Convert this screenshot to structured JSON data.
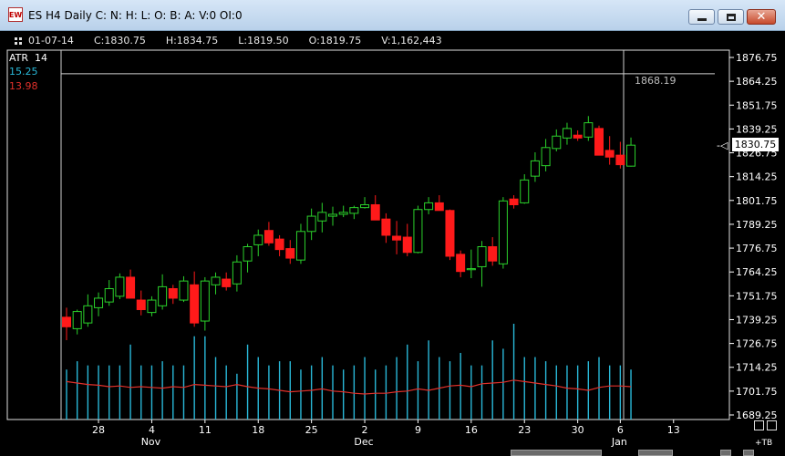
{
  "window": {
    "title": "ES H4 Daily C: N: H: L: O: B: A: V:0 OI:0",
    "app_icon_text": "EW"
  },
  "ohlc": {
    "date": "01-07-14",
    "close": "C:1830.75",
    "high": "H:1834.75",
    "low": "L:1819.50",
    "open": "O:1819.75",
    "volume": "V:1,162,443"
  },
  "indicator": {
    "name": "ATR",
    "period": "14",
    "value1": "15.25",
    "value2": "13.98"
  },
  "current_price": "1830.75",
  "crosshair_price": "1868.19",
  "toolbar_label": "+TB",
  "colors": {
    "up": "#2bd12b",
    "down": "#ff1a1a",
    "volume": "#29b8d8",
    "atr_line": "#e0302a",
    "axis_text": "#ffffff"
  },
  "chart_data": {
    "type": "candlestick",
    "y_ticks": [
      "1876.75",
      "1864.25",
      "1851.75",
      "1839.25",
      "1826.75",
      "1814.25",
      "1801.75",
      "1789.25",
      "1776.75",
      "1764.25",
      "1751.75",
      "1739.25",
      "1726.75",
      "1714.25",
      "1701.75",
      "1689.25"
    ],
    "ylim": [
      1689.25,
      1876.75
    ],
    "x_ticks": [
      "28",
      "4",
      "11",
      "18",
      "25",
      "2",
      "9",
      "16",
      "23",
      "30",
      "6",
      "13"
    ],
    "months": [
      "Nov",
      "Dec",
      "Jan"
    ],
    "candles": [
      {
        "o": 1740.5,
        "h": 1745.5,
        "l": 1728.5,
        "c": 1735.5
      },
      {
        "o": 1734.5,
        "h": 1744.5,
        "l": 1731.5,
        "c": 1743.5
      },
      {
        "o": 1737.5,
        "h": 1752.5,
        "l": 1735.5,
        "c": 1746.5
      },
      {
        "o": 1745.5,
        "h": 1753.5,
        "l": 1741.0,
        "c": 1750.5
      },
      {
        "o": 1748.5,
        "h": 1760.0,
        "l": 1746.5,
        "c": 1755.5
      },
      {
        "o": 1751.5,
        "h": 1763.5,
        "l": 1750.0,
        "c": 1761.5
      },
      {
        "o": 1761.5,
        "h": 1765.5,
        "l": 1750.5,
        "c": 1750.5
      },
      {
        "o": 1749.5,
        "h": 1754.5,
        "l": 1741.5,
        "c": 1744.5
      },
      {
        "o": 1743.0,
        "h": 1751.5,
        "l": 1741.0,
        "c": 1749.5
      },
      {
        "o": 1746.5,
        "h": 1763.0,
        "l": 1744.5,
        "c": 1756.5
      },
      {
        "o": 1755.5,
        "h": 1757.5,
        "l": 1747.5,
        "c": 1750.5
      },
      {
        "o": 1749.5,
        "h": 1762.0,
        "l": 1748.5,
        "c": 1759.5
      },
      {
        "o": 1757.5,
        "h": 1764.5,
        "l": 1735.5,
        "c": 1737.5
      },
      {
        "o": 1738.5,
        "h": 1761.5,
        "l": 1733.5,
        "c": 1759.5
      },
      {
        "o": 1757.5,
        "h": 1764.0,
        "l": 1752.5,
        "c": 1761.5
      },
      {
        "o": 1760.5,
        "h": 1764.0,
        "l": 1754.5,
        "c": 1756.5
      },
      {
        "o": 1758.0,
        "h": 1773.0,
        "l": 1754.0,
        "c": 1769.5
      },
      {
        "o": 1770.0,
        "h": 1779.0,
        "l": 1764.0,
        "c": 1777.5
      },
      {
        "o": 1778.5,
        "h": 1786.5,
        "l": 1772.5,
        "c": 1783.5
      },
      {
        "o": 1786.0,
        "h": 1790.5,
        "l": 1778.0,
        "c": 1779.5
      },
      {
        "o": 1781.5,
        "h": 1783.5,
        "l": 1772.5,
        "c": 1776.0
      },
      {
        "o": 1776.5,
        "h": 1781.0,
        "l": 1768.5,
        "c": 1771.5
      },
      {
        "o": 1770.5,
        "h": 1789.5,
        "l": 1768.5,
        "c": 1785.5
      },
      {
        "o": 1785.5,
        "h": 1797.5,
        "l": 1781.0,
        "c": 1793.5
      },
      {
        "o": 1791.0,
        "h": 1800.5,
        "l": 1785.0,
        "c": 1795.5
      },
      {
        "o": 1793.5,
        "h": 1798.5,
        "l": 1788.5,
        "c": 1794.5
      },
      {
        "o": 1794.5,
        "h": 1799.0,
        "l": 1793.0,
        "c": 1795.5
      },
      {
        "o": 1795.0,
        "h": 1799.0,
        "l": 1792.0,
        "c": 1798.0
      },
      {
        "o": 1798.0,
        "h": 1803.5,
        "l": 1797.5,
        "c": 1799.5
      },
      {
        "o": 1799.5,
        "h": 1804.5,
        "l": 1791.5,
        "c": 1791.5
      },
      {
        "o": 1792.0,
        "h": 1795.0,
        "l": 1779.5,
        "c": 1783.5
      },
      {
        "o": 1783.0,
        "h": 1791.0,
        "l": 1773.5,
        "c": 1781.0
      },
      {
        "o": 1782.5,
        "h": 1789.5,
        "l": 1772.5,
        "c": 1774.5
      },
      {
        "o": 1774.5,
        "h": 1799.0,
        "l": 1774.0,
        "c": 1797.0
      },
      {
        "o": 1797.0,
        "h": 1803.5,
        "l": 1794.5,
        "c": 1800.5
      },
      {
        "o": 1800.5,
        "h": 1804.5,
        "l": 1796.5,
        "c": 1796.5
      },
      {
        "o": 1796.5,
        "h": 1797.0,
        "l": 1770.5,
        "c": 1772.5
      },
      {
        "o": 1773.5,
        "h": 1775.5,
        "l": 1761.5,
        "c": 1764.5
      },
      {
        "o": 1765.5,
        "h": 1776.0,
        "l": 1761.0,
        "c": 1766.0
      },
      {
        "o": 1767.0,
        "h": 1780.5,
        "l": 1756.5,
        "c": 1777.5
      },
      {
        "o": 1777.5,
        "h": 1782.5,
        "l": 1767.5,
        "c": 1770.0
      },
      {
        "o": 1768.5,
        "h": 1803.5,
        "l": 1766.0,
        "c": 1801.5
      },
      {
        "o": 1802.5,
        "h": 1804.5,
        "l": 1797.5,
        "c": 1799.5
      },
      {
        "o": 1800.5,
        "h": 1815.5,
        "l": 1800.0,
        "c": 1812.5
      },
      {
        "o": 1814.5,
        "h": 1827.0,
        "l": 1811.5,
        "c": 1822.5
      },
      {
        "o": 1820.0,
        "h": 1834.0,
        "l": 1817.0,
        "c": 1829.5
      },
      {
        "o": 1829.0,
        "h": 1839.0,
        "l": 1827.5,
        "c": 1835.5
      },
      {
        "o": 1834.5,
        "h": 1842.5,
        "l": 1831.0,
        "c": 1839.5
      },
      {
        "o": 1836.0,
        "h": 1838.5,
        "l": 1833.0,
        "c": 1834.5
      },
      {
        "o": 1835.0,
        "h": 1846.0,
        "l": 1833.0,
        "c": 1842.5
      },
      {
        "o": 1839.5,
        "h": 1841.0,
        "l": 1826.5,
        "c": 1825.5
      },
      {
        "o": 1828.0,
        "h": 1835.5,
        "l": 1820.5,
        "c": 1824.5
      },
      {
        "o": 1825.5,
        "h": 1832.5,
        "l": 1818.5,
        "c": 1820.5
      },
      {
        "o": 1819.75,
        "h": 1834.75,
        "l": 1819.5,
        "c": 1830.75
      }
    ],
    "volume_scale_max": 2.3,
    "volume_millions": [
      1.2,
      1.4,
      1.3,
      1.3,
      1.3,
      1.3,
      1.8,
      1.3,
      1.3,
      1.4,
      1.3,
      1.3,
      2.0,
      2.0,
      1.5,
      1.3,
      1.1,
      1.8,
      1.5,
      1.3,
      1.4,
      1.4,
      1.2,
      1.3,
      1.5,
      1.3,
      1.2,
      1.3,
      1.5,
      1.2,
      1.3,
      1.5,
      1.8,
      1.4,
      1.9,
      1.5,
      1.4,
      1.6,
      1.3,
      1.3,
      1.9,
      1.7,
      2.8,
      1.5,
      1.5,
      1.4,
      1.3,
      1.3,
      1.3,
      1.4,
      1.5,
      1.3,
      1.3,
      1.2
    ],
    "atr": [
      13.2,
      13.0,
      12.8,
      12.7,
      12.5,
      12.6,
      12.4,
      12.5,
      12.4,
      12.3,
      12.5,
      12.4,
      12.8,
      12.7,
      12.6,
      12.5,
      12.8,
      12.5,
      12.3,
      12.2,
      12.0,
      11.8,
      11.9,
      12.0,
      12.2,
      11.9,
      11.8,
      11.6,
      11.5,
      11.6,
      11.6,
      11.8,
      11.9,
      12.2,
      12.0,
      12.3,
      12.6,
      12.7,
      12.5,
      12.9,
      13.0,
      13.1,
      13.4,
      13.2,
      13.0,
      12.8,
      12.6,
      12.3,
      12.2,
      12.0,
      12.4,
      12.6,
      12.6,
      12.5
    ]
  }
}
